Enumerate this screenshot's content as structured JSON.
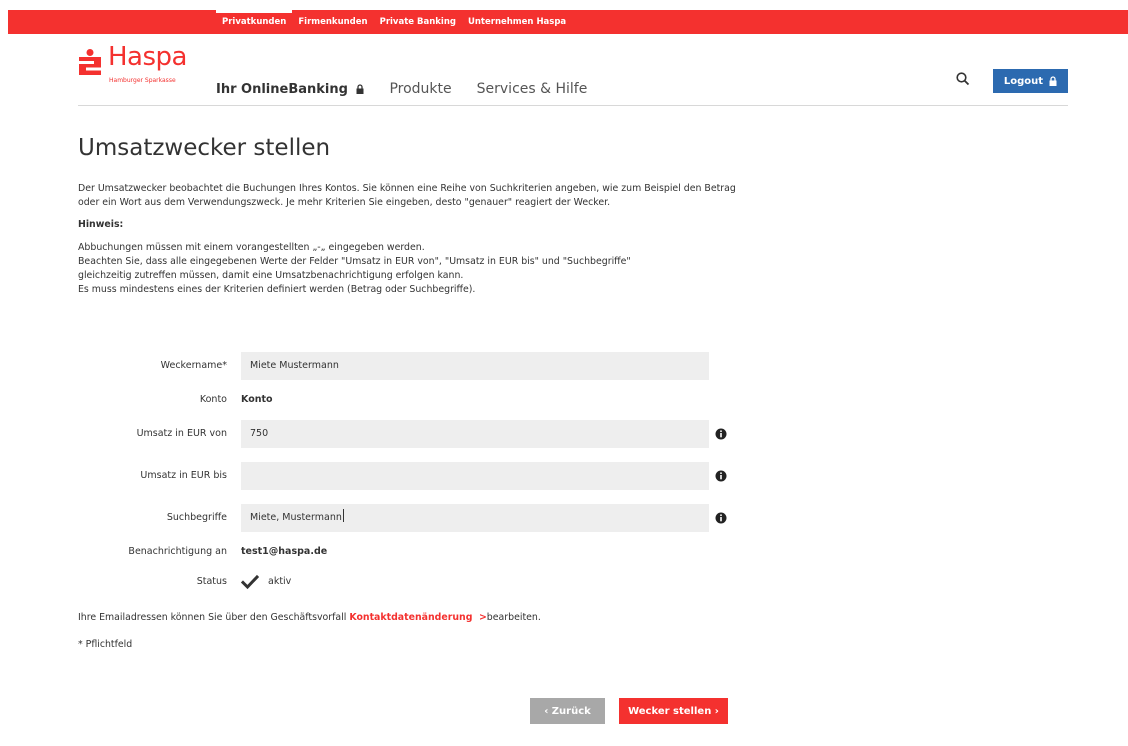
{
  "topnav": {
    "items": [
      {
        "label": "Privatkunden",
        "active": true
      },
      {
        "label": "Firmenkunden",
        "active": false
      },
      {
        "label": "Private Banking",
        "active": false
      },
      {
        "label": "Unternehmen Haspa",
        "active": false
      }
    ]
  },
  "logo": {
    "name": "Haspa",
    "subtitle": "Hamburger Sparkasse"
  },
  "mainnav": {
    "online_banking": "Ihr OnlineBanking",
    "produkte": "Produkte",
    "services": "Services & Hilfe"
  },
  "header": {
    "logout_label": "Logout"
  },
  "page": {
    "title": "Umsatzwecker stellen",
    "intro": "Der Umsatzwecker beobachtet die Buchungen Ihres Kontos. Sie können eine Reihe von Suchkriterien angeben, wie zum Beispiel den Betrag oder ein Wort aus dem Verwendungszweck. Je mehr Kriterien Sie eingeben, desto \"genauer\" reagiert der Wecker.",
    "hint_title": "Hinweis:",
    "hint_lines": [
      "Abbuchungen müssen mit einem vorangestellten „-„ eingegeben werden.",
      "Beachten Sie, dass alle eingegebenen Werte der Felder \"Umsatz in EUR von\", \"Umsatz in EUR bis\" und \"Suchbegriffe\"",
      "gleichzeitig zutreffen müssen, damit eine Umsatzbenachrichtigung erfolgen kann.",
      "Es muss mindestens eines der Kriterien definiert werden (Betrag oder Suchbegriffe)."
    ]
  },
  "form": {
    "weckername": {
      "label": "Weckername*",
      "value": "Miete Mustermann"
    },
    "konto": {
      "label": "Konto",
      "value": "Konto"
    },
    "umsatz_von": {
      "label": "Umsatz in EUR von",
      "value": "750"
    },
    "umsatz_bis": {
      "label": "Umsatz in EUR bis",
      "value": ""
    },
    "suchbegriffe": {
      "label": "Suchbegriffe",
      "value": "Miete, Mustermann"
    },
    "benachrichtigung": {
      "label": "Benachrichtigung an",
      "value": "test1@haspa.de"
    },
    "status": {
      "label": "Status",
      "checkbox_label": "aktiv",
      "checked": true
    }
  },
  "notes": {
    "email_prefix": "Ihre Emailadressen können Sie über den Geschäftsvorfall ",
    "email_link": "Kontaktdatenänderung",
    "email_link_arrow": ">",
    "email_suffix": "bearbeiten.",
    "required": "* Pflichtfeld"
  },
  "buttons": {
    "back": "‹ Zurück",
    "submit": "Wecker stellen ›"
  },
  "colors": {
    "brand_red": "#f4312f",
    "logout_blue": "#2c6ab0",
    "back_gray": "#a8a8a8"
  }
}
